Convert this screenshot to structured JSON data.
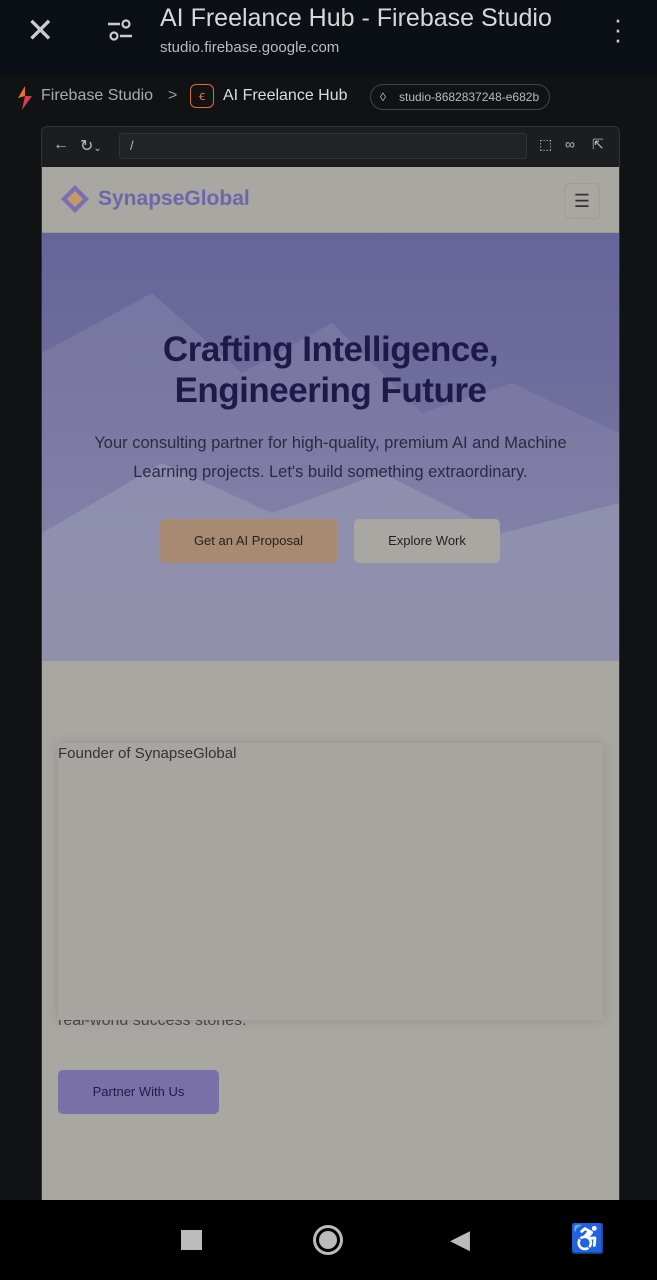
{
  "browser": {
    "title": "AI Freelance Hub - Firebase Studio",
    "url": "studio.firebase.google.com"
  },
  "breadcrumb": {
    "root": "Firebase Studio",
    "separator": ">",
    "app": "AI Freelance Hub",
    "project_id": "studio-8682837248-e682b"
  },
  "preview": {
    "address": "/"
  },
  "site": {
    "brand": "SynapseGlobal",
    "hero_title_line1": "Crafting Intelligence,",
    "hero_title_line2": "Engineering Future",
    "hero_subtitle": "Your consulting partner for high-quality, premium AI and Machine Learning projects. Let's build something extraordinary.",
    "cta_primary": "Get an AI Proposal",
    "cta_secondary": "Explore Work",
    "founder_image_alt": "Founder of SynapseGlobal",
    "about_tail": "real-world success stories.",
    "partner_button": "Partner With Us"
  },
  "colors": {
    "brand": "#6d66aa",
    "accent": "#a88a72",
    "partner": "#7a70a8"
  }
}
